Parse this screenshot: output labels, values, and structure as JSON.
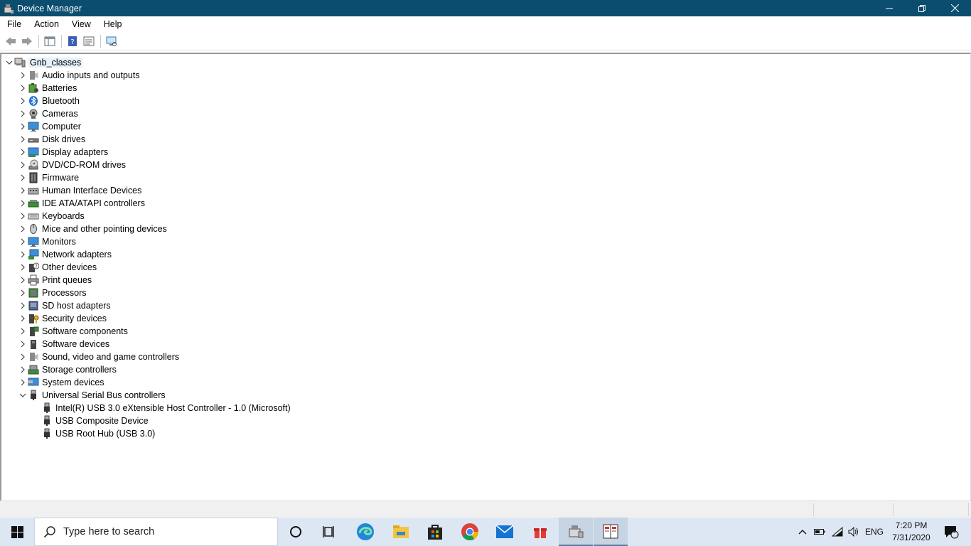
{
  "window": {
    "title": "Device Manager",
    "controls": {
      "minimize": "—",
      "restore": "❐",
      "close": "✕"
    }
  },
  "menu": [
    "File",
    "Action",
    "View",
    "Help"
  ],
  "toolbar": {
    "icons": [
      "back-arrow-icon",
      "forward-arrow-icon",
      "show-hide-console-tree-icon",
      "help-icon",
      "properties-icon",
      "scan-hardware-icon"
    ]
  },
  "tree": {
    "root": {
      "label": "Gnb_classes",
      "icon": "computer-icon",
      "expanded": true
    },
    "categories": [
      {
        "label": "Audio inputs and outputs",
        "icon": "speaker-icon",
        "expanded": false
      },
      {
        "label": "Batteries",
        "icon": "battery-icon",
        "expanded": false
      },
      {
        "label": "Bluetooth",
        "icon": "bluetooth-icon",
        "expanded": false
      },
      {
        "label": "Cameras",
        "icon": "camera-icon",
        "expanded": false
      },
      {
        "label": "Computer",
        "icon": "monitor-icon",
        "expanded": false
      },
      {
        "label": "Disk drives",
        "icon": "disk-drive-icon",
        "expanded": false
      },
      {
        "label": "Display adapters",
        "icon": "display-adapter-icon",
        "expanded": false
      },
      {
        "label": "DVD/CD-ROM drives",
        "icon": "dvd-icon",
        "expanded": false
      },
      {
        "label": "Firmware",
        "icon": "firmware-icon",
        "expanded": false
      },
      {
        "label": "Human Interface Devices",
        "icon": "hid-icon",
        "expanded": false
      },
      {
        "label": "IDE ATA/ATAPI controllers",
        "icon": "ide-controller-icon",
        "expanded": false
      },
      {
        "label": "Keyboards",
        "icon": "keyboard-icon",
        "expanded": false
      },
      {
        "label": "Mice and other pointing devices",
        "icon": "mouse-icon",
        "expanded": false
      },
      {
        "label": "Monitors",
        "icon": "monitor-icon",
        "expanded": false
      },
      {
        "label": "Network adapters",
        "icon": "network-adapter-icon",
        "expanded": false
      },
      {
        "label": "Other devices",
        "icon": "unknown-device-icon",
        "expanded": false
      },
      {
        "label": "Print queues",
        "icon": "printer-icon",
        "expanded": false
      },
      {
        "label": "Processors",
        "icon": "processor-icon",
        "expanded": false
      },
      {
        "label": "SD host adapters",
        "icon": "sd-card-icon",
        "expanded": false
      },
      {
        "label": "Security devices",
        "icon": "security-device-icon",
        "expanded": false
      },
      {
        "label": "Software components",
        "icon": "software-component-icon",
        "expanded": false
      },
      {
        "label": "Software devices",
        "icon": "software-device-icon",
        "expanded": false
      },
      {
        "label": "Sound, video and game controllers",
        "icon": "speaker-icon",
        "expanded": false
      },
      {
        "label": "Storage controllers",
        "icon": "storage-controller-icon",
        "expanded": false
      },
      {
        "label": "System devices",
        "icon": "system-device-icon",
        "expanded": false
      },
      {
        "label": "Universal Serial Bus controllers",
        "icon": "usb-icon",
        "expanded": true,
        "children": [
          {
            "label": "Intel(R) USB 3.0 eXtensible Host Controller - 1.0 (Microsoft)",
            "icon": "usb-icon"
          },
          {
            "label": "USB Composite Device",
            "icon": "usb-icon"
          },
          {
            "label": "USB Root Hub (USB 3.0)",
            "icon": "usb-icon"
          }
        ]
      }
    ]
  },
  "taskbar": {
    "search_placeholder": "Type here to search",
    "apps": [
      "cortana-icon",
      "task-view-icon",
      "edge-icon",
      "file-explorer-icon",
      "store-icon",
      "chrome-icon",
      "mail-icon",
      "gift-icon",
      "device-manager-icon",
      "book-app-icon"
    ],
    "tray": {
      "language": "ENG",
      "time": "7:20 PM",
      "date": "7/31/2020",
      "notification_count": "1"
    }
  },
  "colors": {
    "titlebar": "#0b4d6e",
    "selection": "#e5f1fb",
    "taskbar": "#dde7f3"
  }
}
